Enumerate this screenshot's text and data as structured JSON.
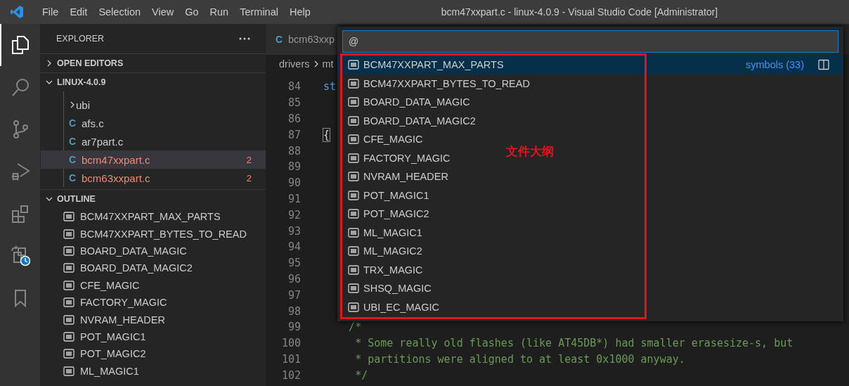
{
  "title_bar": {
    "menu": [
      "File",
      "Edit",
      "Selection",
      "View",
      "Go",
      "Run",
      "Terminal",
      "Help"
    ],
    "title": "bcm47xxpart.c - linux-4.0.9 - Visual Studio Code [Administrator]"
  },
  "activity_bar": [
    {
      "kind": "files",
      "selected": true
    },
    {
      "kind": "search",
      "selected": false
    },
    {
      "kind": "source-control",
      "selected": false
    },
    {
      "kind": "debug",
      "selected": false
    },
    {
      "kind": "extensions",
      "selected": false
    },
    {
      "kind": "timeline",
      "selected": false
    },
    {
      "kind": "bookmark",
      "selected": false
    }
  ],
  "sidebar": {
    "title": "EXPLORER",
    "open_editors": {
      "label": "OPEN EDITORS",
      "expanded": false
    },
    "folder": {
      "label": "LINUX-4.0.9",
      "expanded": true,
      "items": [
        {
          "kind": "folder",
          "name": "ubi",
          "selected": false,
          "error": false
        },
        {
          "kind": "file",
          "icon": "C",
          "name": "afs.c",
          "selected": false,
          "error": false
        },
        {
          "kind": "file",
          "icon": "C",
          "name": "ar7part.c",
          "selected": false,
          "error": false
        },
        {
          "kind": "file",
          "icon": "C",
          "name": "bcm47xxpart.c",
          "selected": true,
          "error": true,
          "problems": "2"
        },
        {
          "kind": "file",
          "icon": "C",
          "name": "bcm63xxpart.c",
          "selected": false,
          "error": true,
          "problems": "2"
        }
      ]
    },
    "outline": {
      "label": "OUTLINE",
      "expanded": true,
      "items": [
        "BCM47XXPART_MAX_PARTS",
        "BCM47XXPART_BYTES_TO_READ",
        "BOARD_DATA_MAGIC",
        "BOARD_DATA_MAGIC2",
        "CFE_MAGIC",
        "FACTORY_MAGIC",
        "NVRAM_HEADER",
        "POT_MAGIC1",
        "POT_MAGIC2",
        "ML_MAGIC1"
      ]
    }
  },
  "editor": {
    "tab": {
      "icon": "C",
      "label": "bcm63xxp"
    },
    "breadcrumb": [
      "drivers",
      "mt"
    ],
    "lines": [
      {
        "number": "84",
        "kind": "keyword",
        "code": "st"
      },
      {
        "number": "85"
      },
      {
        "number": "86"
      },
      {
        "number": "87",
        "kind": "bracket",
        "code": "{"
      },
      {
        "number": "88"
      },
      {
        "number": "89"
      },
      {
        "number": "90"
      },
      {
        "number": "91"
      },
      {
        "number": "92"
      },
      {
        "number": "93"
      },
      {
        "number": "94"
      },
      {
        "number": "95"
      },
      {
        "number": "96"
      },
      {
        "number": "97"
      },
      {
        "number": "98"
      },
      {
        "number": "99",
        "kind": "comment",
        "code": "    /*"
      },
      {
        "number": "100",
        "kind": "comment",
        "code": "     * Some really old flashes (like AT45DB*) had smaller erasesize-s, but"
      },
      {
        "number": "101",
        "kind": "comment",
        "code": "     * partitions were aligned to at least 0x1000 anyway."
      },
      {
        "number": "102",
        "kind": "comment",
        "code": "     */"
      }
    ]
  },
  "quick_pick": {
    "value": "@",
    "count": "symbols (33)",
    "items": [
      {
        "label": "BCM47XXPART_MAX_PARTS",
        "selected": true
      },
      {
        "label": "BCM47XXPART_BYTES_TO_READ",
        "selected": false
      },
      {
        "label": "BOARD_DATA_MAGIC",
        "selected": false
      },
      {
        "label": "BOARD_DATA_MAGIC2",
        "selected": false
      },
      {
        "label": "CFE_MAGIC",
        "selected": false
      },
      {
        "label": "FACTORY_MAGIC",
        "selected": false
      },
      {
        "label": "NVRAM_HEADER",
        "selected": false
      },
      {
        "label": "POT_MAGIC1",
        "selected": false
      },
      {
        "label": "POT_MAGIC2",
        "selected": false
      },
      {
        "label": "ML_MAGIC1",
        "selected": false
      },
      {
        "label": "ML_MAGIC2",
        "selected": false
      },
      {
        "label": "TRX_MAGIC",
        "selected": false
      },
      {
        "label": "SHSQ_MAGIC",
        "selected": false
      },
      {
        "label": "UBI_EC_MAGIC",
        "selected": false
      }
    ]
  },
  "annotation": {
    "label": "文件大纲"
  }
}
